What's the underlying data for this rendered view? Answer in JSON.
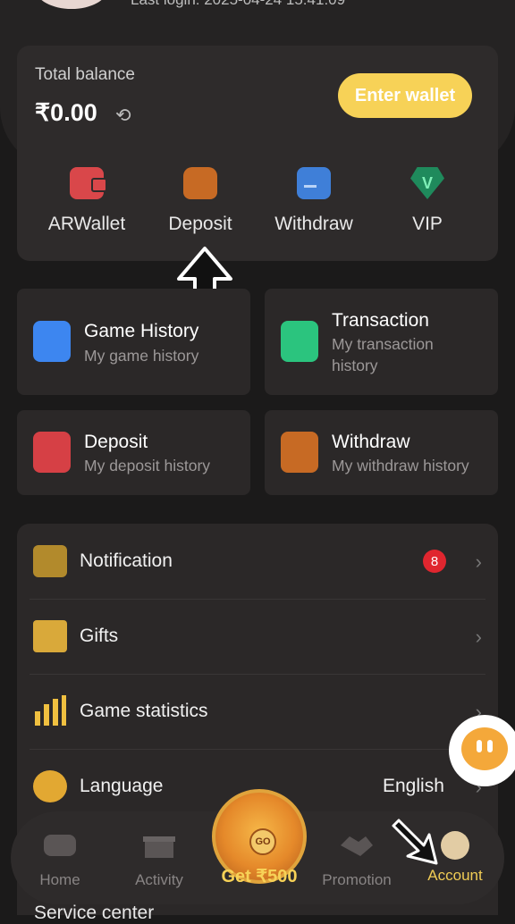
{
  "header": {
    "last_login": "Last login: 2025-04-24 15:41:09"
  },
  "balance": {
    "label": "Total balance",
    "amount": "₹0.00",
    "enter_wallet": "Enter wallet",
    "quick": [
      {
        "label": "ARWallet",
        "icon": "wallet-icon",
        "color": "#d9474a"
      },
      {
        "label": "Deposit",
        "icon": "deposit-icon",
        "color": "#c76a24"
      },
      {
        "label": "Withdraw",
        "icon": "card-icon",
        "color": "#3f7fd8"
      },
      {
        "label": "VIP",
        "icon": "vip-icon",
        "color": "#1f8a5c"
      }
    ]
  },
  "tiles": [
    {
      "title": "Game History",
      "subtitle": "My game history",
      "icon": "game-history-icon",
      "color": "#3d86f0"
    },
    {
      "title": "Transaction",
      "subtitle": "My transaction history",
      "icon": "transaction-icon",
      "color": "#2bc47e"
    },
    {
      "title": "Deposit",
      "subtitle": "My deposit history",
      "icon": "deposit-history-icon",
      "color": "#d64045"
    },
    {
      "title": "Withdraw",
      "subtitle": "My withdraw history",
      "icon": "withdraw-history-icon",
      "color": "#c76a24"
    }
  ],
  "menu": [
    {
      "label": "Notification",
      "badge": "8",
      "icon": "envelope-icon"
    },
    {
      "label": "Gifts",
      "icon": "gift-icon"
    },
    {
      "label": "Game statistics",
      "icon": "bar-chart-icon"
    },
    {
      "label": "Language",
      "value": "English",
      "icon": "globe-icon"
    }
  ],
  "service_center": "Service center",
  "nav": {
    "home": "Home",
    "activity": "Activity",
    "wheel_label": "Get ₹500",
    "wheel_go": "GO",
    "promotion": "Promotion",
    "account": "Account"
  },
  "colors": {
    "accent": "#f7d257",
    "background": "#1b1a1a",
    "card": "#2b2828"
  }
}
